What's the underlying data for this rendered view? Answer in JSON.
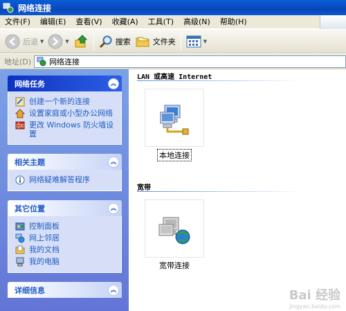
{
  "window": {
    "title": "网络连接"
  },
  "menu": [
    "文件(F)",
    "编辑(E)",
    "查看(V)",
    "收藏(A)",
    "工具(T)",
    "高级(N)",
    "帮助(H)"
  ],
  "toolbar": {
    "back": "后退",
    "search": "搜索",
    "folders": "文件夹"
  },
  "address": {
    "label": "地址(D)",
    "value": "网络连接"
  },
  "panels": {
    "tasks": {
      "title": "网络任务",
      "items": [
        "创建一个新的连接",
        "设置家庭或小型办公网络",
        "更改 Windows 防火墙设置"
      ]
    },
    "related": {
      "title": "相关主题",
      "items": [
        "网络疑难解答程序"
      ]
    },
    "other": {
      "title": "其它位置",
      "items": [
        "控制面板",
        "网上邻居",
        "我的文档",
        "我的电脑"
      ]
    },
    "details": {
      "title": "详细信息"
    }
  },
  "groups": [
    {
      "title": "LAN 或高速 Internet",
      "connection": "本地连接"
    },
    {
      "title": "宽带",
      "connection": "宽带连接"
    }
  ],
  "watermark": {
    "brand": "Bai 经验",
    "url": "jingyan.baidu.com"
  }
}
